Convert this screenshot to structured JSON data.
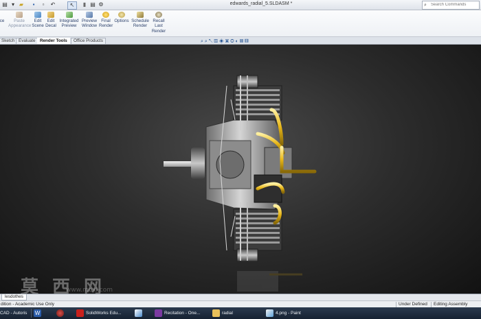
{
  "window": {
    "title": "edwards_radial_5.SLDASM *",
    "search_placeholder": "Search Commands"
  },
  "quick_access": {
    "icons": [
      "new-file-icon",
      "open-file-icon",
      "save-icon",
      "print-icon",
      "undo-icon",
      "select-icon",
      "rebuild-icon",
      "file-properties-icon",
      "options-icon"
    ]
  },
  "ribbon": {
    "items": [
      {
        "label": "ce"
      },
      {
        "label": "Paste\nAppearance"
      },
      {
        "label": "Edit\nScene"
      },
      {
        "label": "Edit\nDecal"
      },
      {
        "label": "Integrated\nPreview"
      },
      {
        "label": "Preview\nWindow"
      },
      {
        "label": "Final\nRender"
      },
      {
        "label": "Options"
      },
      {
        "label": "Schedule\nRender"
      },
      {
        "label": "Recall\nLast\nRender"
      }
    ]
  },
  "command_tabs": [
    "Sketch",
    "Evaluate",
    "Render Tools",
    "Office Products"
  ],
  "active_tab": "Render Tools",
  "bottom_tabs": [
    "lesdothes"
  ],
  "status": {
    "left": "dition - Academic Use Only",
    "defined": "Under Defined",
    "mode": "Editing Assembly"
  },
  "taskbar": {
    "items": [
      {
        "label": "CAD - Autoris"
      },
      {
        "label": ""
      },
      {
        "label": ""
      },
      {
        "label": "SolidWorks Edu..."
      },
      {
        "label": ""
      },
      {
        "label": "Recitation - One..."
      },
      {
        "label": "radial"
      },
      {
        "label": "4.png - Paint"
      }
    ]
  },
  "watermark": {
    "text": "莫西网",
    "sub": "www.moxi.com"
  },
  "colors": {
    "pipe_yellow": "#e8b719",
    "viewport_bg": "#2a2a2a",
    "ribbon_text": "#2a3f6a"
  }
}
